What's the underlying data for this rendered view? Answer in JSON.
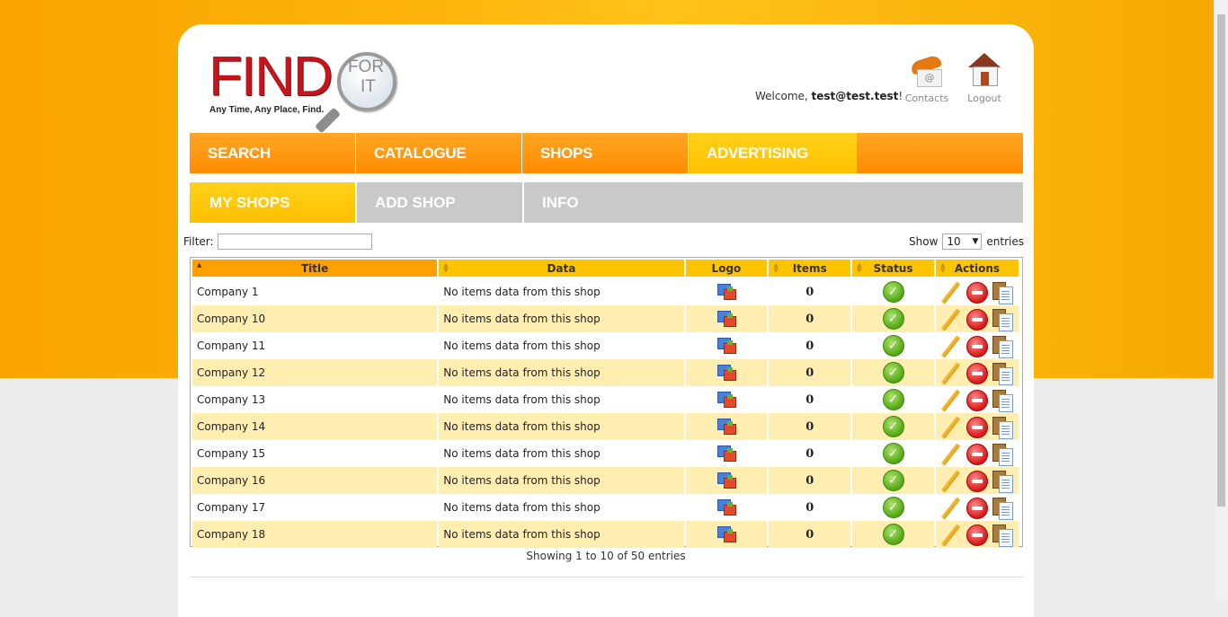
{
  "brand": {
    "logo_word": "FIND",
    "logo_for": "FOR",
    "logo_it": "IT",
    "tagline": "Any Time, Any Place, Find.",
    "accent_orange": "#ff8b00",
    "accent_yellow": "#ffc400"
  },
  "header": {
    "welcome_prefix": "Welcome, ",
    "user_email": "test@test.test",
    "welcome_suffix": "!",
    "contacts_label": "Contacts",
    "logout_label": "Logout",
    "contacts_icon": "phone-envelope-icon",
    "logout_icon": "house-icon"
  },
  "main_menu": [
    {
      "label": "SEARCH",
      "active": false
    },
    {
      "label": "CATALOGUE",
      "active": false
    },
    {
      "label": "SHOPS",
      "active": false
    },
    {
      "label": "ADVERTISING",
      "active": true
    }
  ],
  "sub_menu": [
    {
      "label": "MY SHOPS",
      "active": true
    },
    {
      "label": "ADD SHOP",
      "active": false
    },
    {
      "label": "INFO",
      "active": false
    }
  ],
  "filter": {
    "label": "Filter:",
    "value": ""
  },
  "show": {
    "prefix": "Show",
    "selected": "10",
    "suffix": "entries"
  },
  "table": {
    "columns": [
      "Title",
      "Data",
      "Logo",
      "Items",
      "Status",
      "Actions"
    ],
    "sorted_column": "Title",
    "rows": [
      {
        "title": "Company 1",
        "data": "No items data from this shop",
        "items": "0"
      },
      {
        "title": "Company 10",
        "data": "No items data from this shop",
        "items": "0"
      },
      {
        "title": "Company 11",
        "data": "No items data from this shop",
        "items": "0"
      },
      {
        "title": "Company 12",
        "data": "No items data from this shop",
        "items": "0"
      },
      {
        "title": "Company 13",
        "data": "No items data from this shop",
        "items": "0"
      },
      {
        "title": "Company 14",
        "data": "No items data from this shop",
        "items": "0"
      },
      {
        "title": "Company 15",
        "data": "No items data from this shop",
        "items": "0"
      },
      {
        "title": "Company 16",
        "data": "No items data from this shop",
        "items": "0"
      },
      {
        "title": "Company 17",
        "data": "No items data from this shop",
        "items": "0"
      },
      {
        "title": "Company 18",
        "data": "No items data from this shop",
        "items": "0"
      }
    ],
    "row_icons": {
      "logo": "image-icon",
      "status": "check-circle-icon",
      "edit": "pencil-icon",
      "delete": "minus-circle-icon",
      "copy": "clipboard-copy-icon"
    }
  },
  "pagination_info": "Showing 1 to 10 of 50 entries"
}
